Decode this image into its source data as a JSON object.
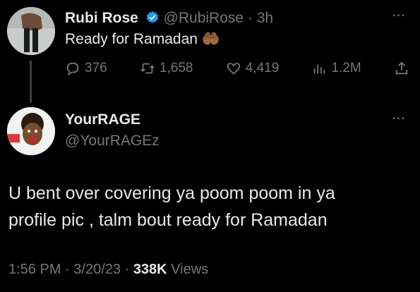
{
  "tweet1": {
    "display_name": "Rubi Rose",
    "handle": "@RubiRose",
    "sep": "·",
    "time": "3h",
    "text": "Ready for Ramadan",
    "emoji": "🤲🏾",
    "replies": "376",
    "retweets": "1,658",
    "likes": "4,419",
    "views": "1.2M",
    "more": "···",
    "icons": [
      "reply-icon",
      "retweet-icon",
      "like-icon",
      "views-icon",
      "share-icon"
    ]
  },
  "tweet2": {
    "display_name": "YourRAGE",
    "handle": "@YourRAGEz",
    "more": "···",
    "text_line1": "U bent over covering ya poom poom in ya",
    "text_line2": "profile pic , talm bout ready for Ramadan",
    "time": "1:56 PM",
    "sep1": "·",
    "date": "3/20/23",
    "sep2": "·",
    "views_count": "338K",
    "views_label": "Views"
  },
  "colors": {
    "background": "#000000",
    "text": "#e7e9ea",
    "muted": "#71767b",
    "verified": "#1d9bf0"
  }
}
